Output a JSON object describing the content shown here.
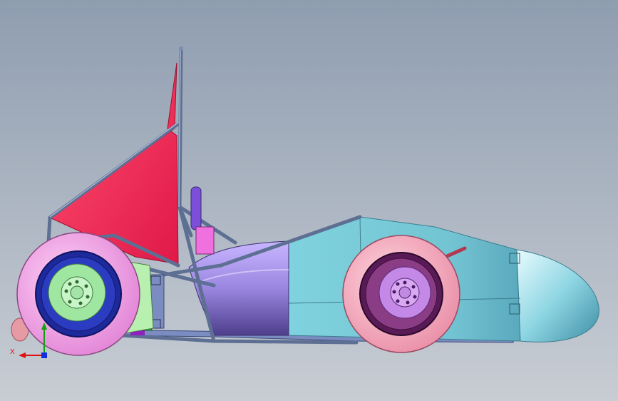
{
  "viewport": {
    "background_top": "#8f9db0",
    "background_bottom": "#c8cdd4"
  },
  "triad": {
    "x_label": "X",
    "x_color": "#e01010",
    "y_color": "#10a010",
    "z_color": "#1030e0"
  },
  "colors": {
    "tube": "#5d6f92",
    "firewall": "#ff2d5c",
    "sidepod": "#a88fe8",
    "nose": "#74c9d8",
    "tire": "#f4a5e8",
    "front_tire": "#f2a8b8",
    "rim_rear": "#1e2a9c",
    "rim_front": "#6a2060",
    "engine": "#b8f0b0"
  }
}
